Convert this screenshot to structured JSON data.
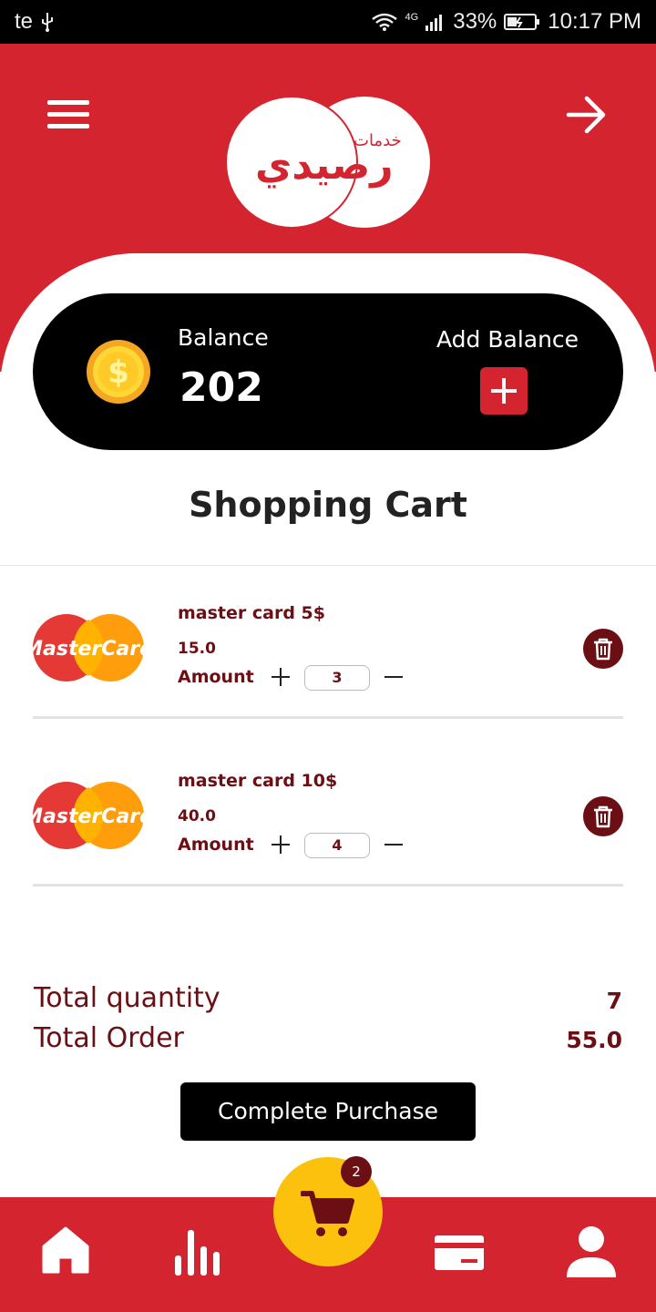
{
  "status_bar": {
    "carrier": "te",
    "network": "4G",
    "battery": "33%",
    "time": "10:17 PM"
  },
  "header": {
    "logo_text_top": "خدمات",
    "logo_text_main": "رصيدي"
  },
  "balance": {
    "label": "Balance",
    "value": "202",
    "add_label": "Add Balance"
  },
  "page_title": "Shopping Cart",
  "cart_items": [
    {
      "name": "master card 5$",
      "price": "15.0",
      "amount_label": "Amount",
      "quantity": "3",
      "card_brand": "MasterCard"
    },
    {
      "name": "master card 10$",
      "price": "40.0",
      "amount_label": "Amount",
      "quantity": "4",
      "card_brand": "MasterCard"
    }
  ],
  "totals": {
    "quantity_label": "Total quantity",
    "quantity_value": "7",
    "order_label": "Total Order",
    "order_value": "55.0"
  },
  "purchase_button": "Complete Purchase",
  "bottom_nav": {
    "cart_badge": "2",
    "items": [
      "home-icon",
      "stats-icon",
      "cart-icon",
      "card-icon",
      "user-icon"
    ]
  },
  "colors": {
    "brand_red": "#d42430",
    "dark_red": "#6b0f14",
    "accent_yellow": "#fcc10d"
  }
}
